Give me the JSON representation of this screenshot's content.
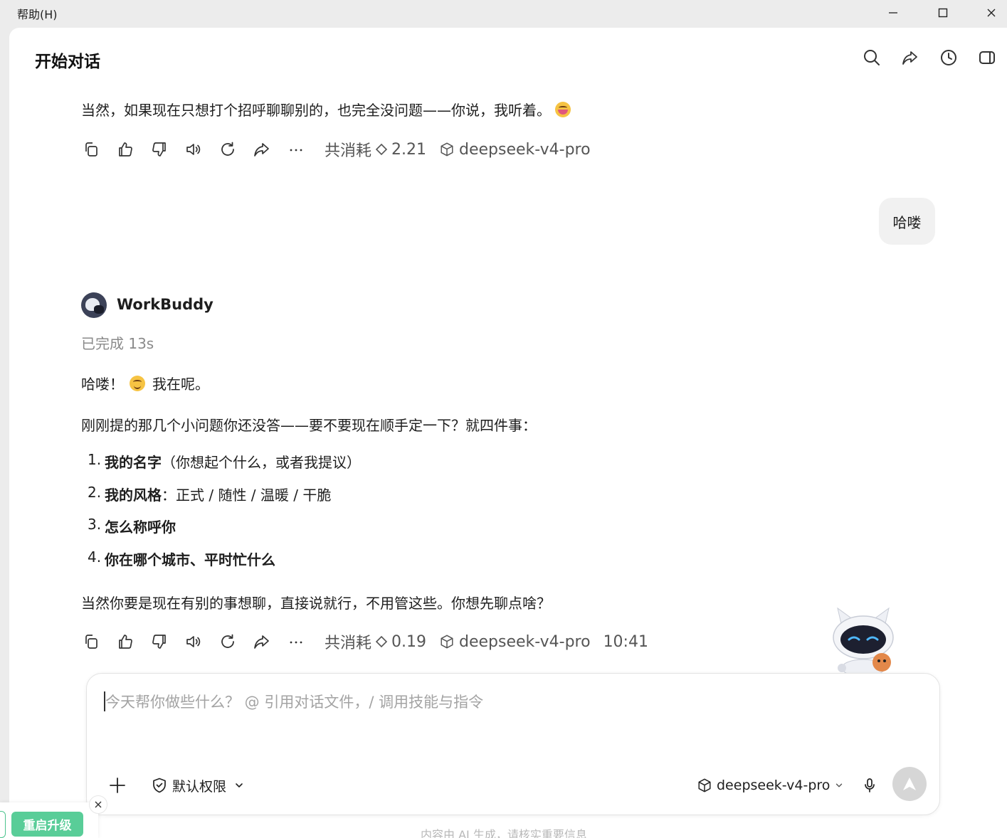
{
  "window": {
    "menu_help": "帮助(H)"
  },
  "header": {
    "title": "开始对话",
    "icons": [
      "search-icon",
      "share-icon",
      "history-icon",
      "sidebar-toggle-icon"
    ]
  },
  "messages": {
    "prev_reply_text": "当然，如果现在只想打个招呼聊聊别的，也完全没问题——你说，我听着。",
    "prev_reply_meta": {
      "cost_label": "共消耗",
      "cost_value": "2.21",
      "model": "deepseek-v4-pro"
    },
    "user_message": "哈喽",
    "bot": {
      "name": "WorkBuddy",
      "status": "已完成 13s",
      "greeting_a": "哈喽！",
      "greeting_b": "我在呢。",
      "intro": "刚刚提的那几个小问题你还没答——要不要现在顺手定一下？就四件事：",
      "list": [
        {
          "num": "1.",
          "bold": "我的名字",
          "rest": "（你想起个什么，或者我提议）"
        },
        {
          "num": "2.",
          "bold": "我的风格",
          "rest": "：正式 / 随性 / 温暖 / 干脆"
        },
        {
          "num": "3.",
          "bold": "怎么称呼你",
          "rest": ""
        },
        {
          "num": "4.",
          "bold": "你在哪个城市、平时忙什么",
          "rest": ""
        }
      ],
      "closing": "当然你要是现在有别的事想聊，直接说就行，不用管这些。你想先聊点啥？",
      "meta": {
        "cost_label": "共消耗",
        "cost_value": "0.19",
        "model": "deepseek-v4-pro",
        "time": "10:41"
      }
    }
  },
  "composer": {
    "placeholder": "今天帮你做些什么？ @ 引用对话文件，/ 调用技能与指令",
    "permission_label": "默认权限",
    "model_label": "deepseek-v4-pro"
  },
  "footer": {
    "disclaimer": "内容由 AI 生成，请核实重要信息"
  },
  "toast": {
    "upgrade_label": "重启升级"
  },
  "colors": {
    "upgrade_green": "#59cd98",
    "send_button": "#d6d6d6",
    "user_bubble": "#f1f1f1"
  }
}
